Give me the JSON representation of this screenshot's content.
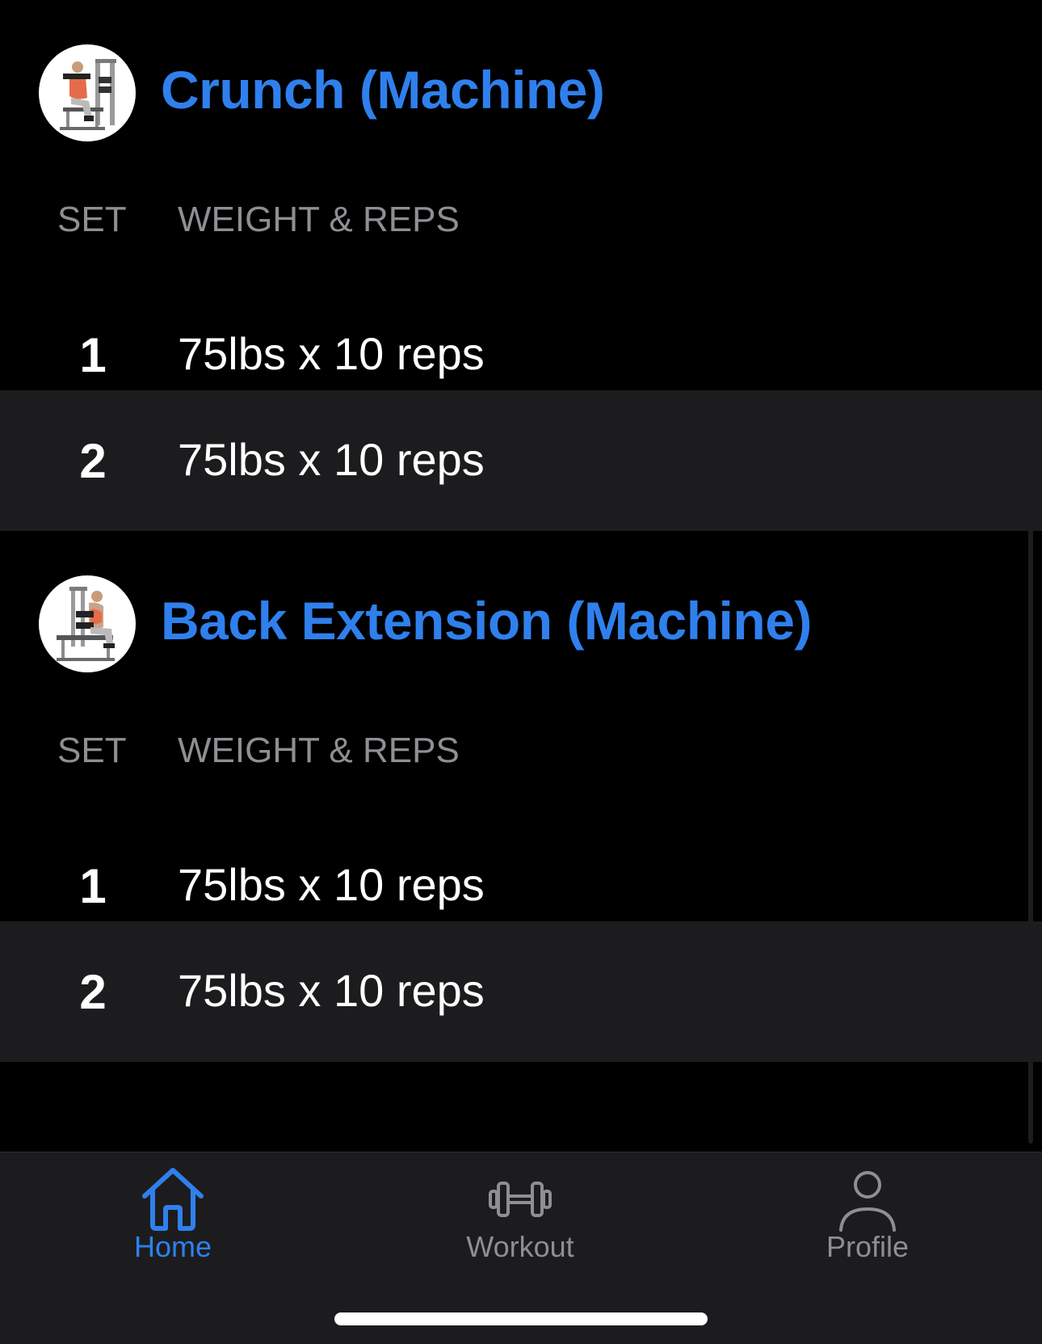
{
  "colors": {
    "accent": "#2f80ed",
    "background": "#000000",
    "alt_row": "#1c1c1e",
    "secondary_text": "#8e8e93",
    "tab_inactive": "#8e8e93"
  },
  "exercises": [
    {
      "title": "Crunch (Machine)",
      "thumbnail_icon": "crunch-machine-illustration",
      "col_set": "SET",
      "col_weight_reps": "WEIGHT & REPS",
      "sets": [
        {
          "num": "1",
          "value": "75lbs x 10 reps"
        },
        {
          "num": "2",
          "value": "75lbs x 10 reps"
        }
      ]
    },
    {
      "title": "Back Extension (Machine)",
      "thumbnail_icon": "back-extension-machine-illustration",
      "col_set": "SET",
      "col_weight_reps": "WEIGHT & REPS",
      "sets": [
        {
          "num": "1",
          "value": "75lbs x 10 reps"
        },
        {
          "num": "2",
          "value": "75lbs x 10 reps"
        }
      ]
    }
  ],
  "tabbar": {
    "selected": "home",
    "tabs": [
      {
        "id": "home",
        "label": "Home",
        "icon": "house-icon"
      },
      {
        "id": "workout",
        "label": "Workout",
        "icon": "dumbbell-icon"
      },
      {
        "id": "profile",
        "label": "Profile",
        "icon": "person-icon"
      }
    ]
  }
}
